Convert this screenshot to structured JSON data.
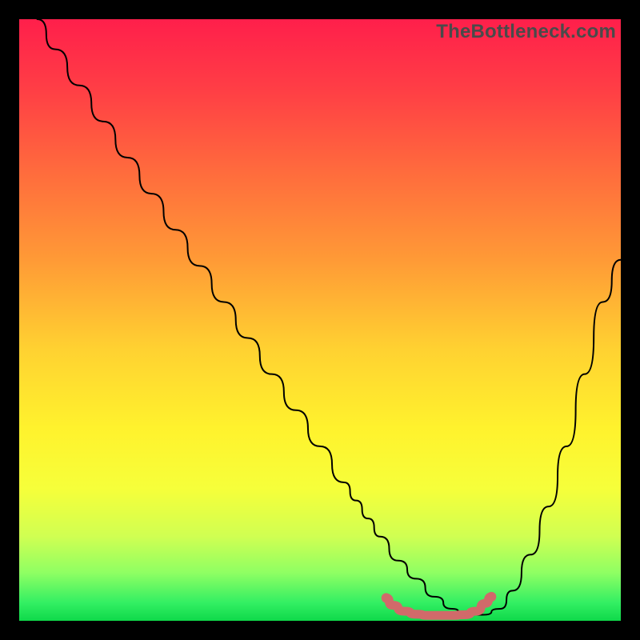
{
  "watermark": "TheBottleneck.com",
  "chart_data": {
    "type": "line",
    "title": "",
    "xlabel": "",
    "ylabel": "",
    "xlim": [
      0,
      100
    ],
    "ylim": [
      0,
      100
    ],
    "background_gradient": {
      "stops": [
        {
          "pos": 0.0,
          "color": "#ff1f4b"
        },
        {
          "pos": 0.12,
          "color": "#ff3f45"
        },
        {
          "pos": 0.25,
          "color": "#ff6a3d"
        },
        {
          "pos": 0.4,
          "color": "#ff9a36"
        },
        {
          "pos": 0.55,
          "color": "#ffd231"
        },
        {
          "pos": 0.68,
          "color": "#fff22d"
        },
        {
          "pos": 0.78,
          "color": "#f6ff3a"
        },
        {
          "pos": 0.86,
          "color": "#d0ff52"
        },
        {
          "pos": 0.92,
          "color": "#8fff63"
        },
        {
          "pos": 0.97,
          "color": "#33ef63"
        },
        {
          "pos": 1.0,
          "color": "#0fd94a"
        }
      ]
    },
    "series": [
      {
        "name": "curve",
        "color": "#000000",
        "stroke_width": 2,
        "x": [
          3,
          6,
          10,
          14,
          18,
          22,
          26,
          30,
          34,
          38,
          42,
          46,
          50,
          54,
          56,
          58,
          60,
          63,
          66,
          69,
          72,
          74,
          77,
          80,
          82,
          85,
          88,
          91,
          94,
          97,
          100
        ],
        "y": [
          100,
          95,
          89,
          83,
          77,
          71,
          65,
          59,
          53,
          47,
          41,
          35,
          29,
          23,
          20,
          17,
          14,
          10,
          7,
          4,
          2,
          1,
          1,
          2,
          5,
          11,
          19,
          29,
          41,
          53,
          60
        ]
      },
      {
        "name": "valley-marker",
        "color": "#d16a6a",
        "stroke_width": 11,
        "x": [
          61,
          62,
          64,
          66,
          68,
          70,
          72,
          74,
          76,
          77.5,
          78.5
        ],
        "y": [
          3.8,
          2.6,
          1.6,
          1.1,
          0.9,
          0.9,
          0.9,
          1.0,
          1.6,
          2.9,
          4.0
        ]
      }
    ]
  }
}
